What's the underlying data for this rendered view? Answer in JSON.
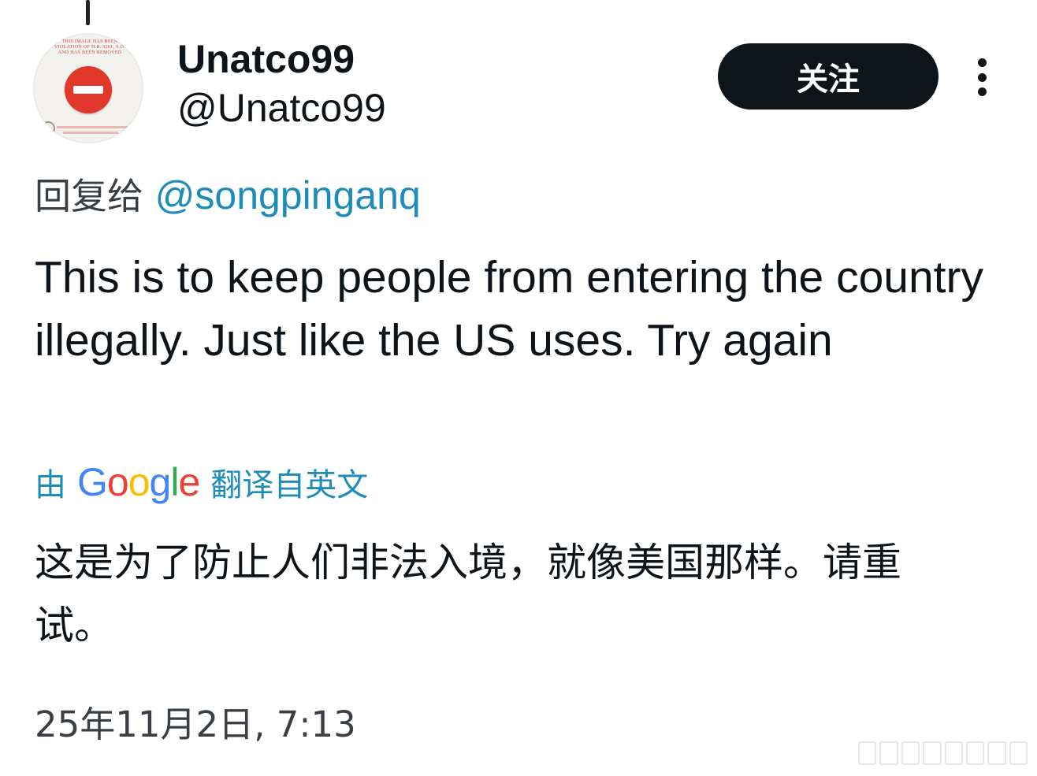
{
  "author": {
    "display_name": "Unatco99",
    "handle": "@Unatco99",
    "avatar_stamp_lines": [
      "THIS IMAGE HAS BEEN",
      "VIOLATION OF H.R. 3261, S.O.",
      "AND HAS BEEN REMOVED"
    ]
  },
  "actions": {
    "follow_label": "关注",
    "more_icon": "more-vertical-icon"
  },
  "reply": {
    "label": "回复给",
    "mention": "@songpinganq"
  },
  "tweet": {
    "text": "This is to keep people from entering the country illegally. Just like the US uses. Try again"
  },
  "translation": {
    "prefix": "由",
    "provider_letters": [
      "G",
      "o",
      "o",
      "g",
      "l",
      "e"
    ],
    "suffix": "翻译自英文",
    "text": "这是为了防止人们非法入境，就像美国那样。请重试。"
  },
  "timestamp": "25年11月2日, 7:13",
  "colors": {
    "link": "#1d8cb8",
    "follow_bg": "#0f1419",
    "google_blue": "#4285f4",
    "google_red": "#ea4335",
    "google_yellow": "#fbbc05",
    "google_green": "#34a853"
  }
}
